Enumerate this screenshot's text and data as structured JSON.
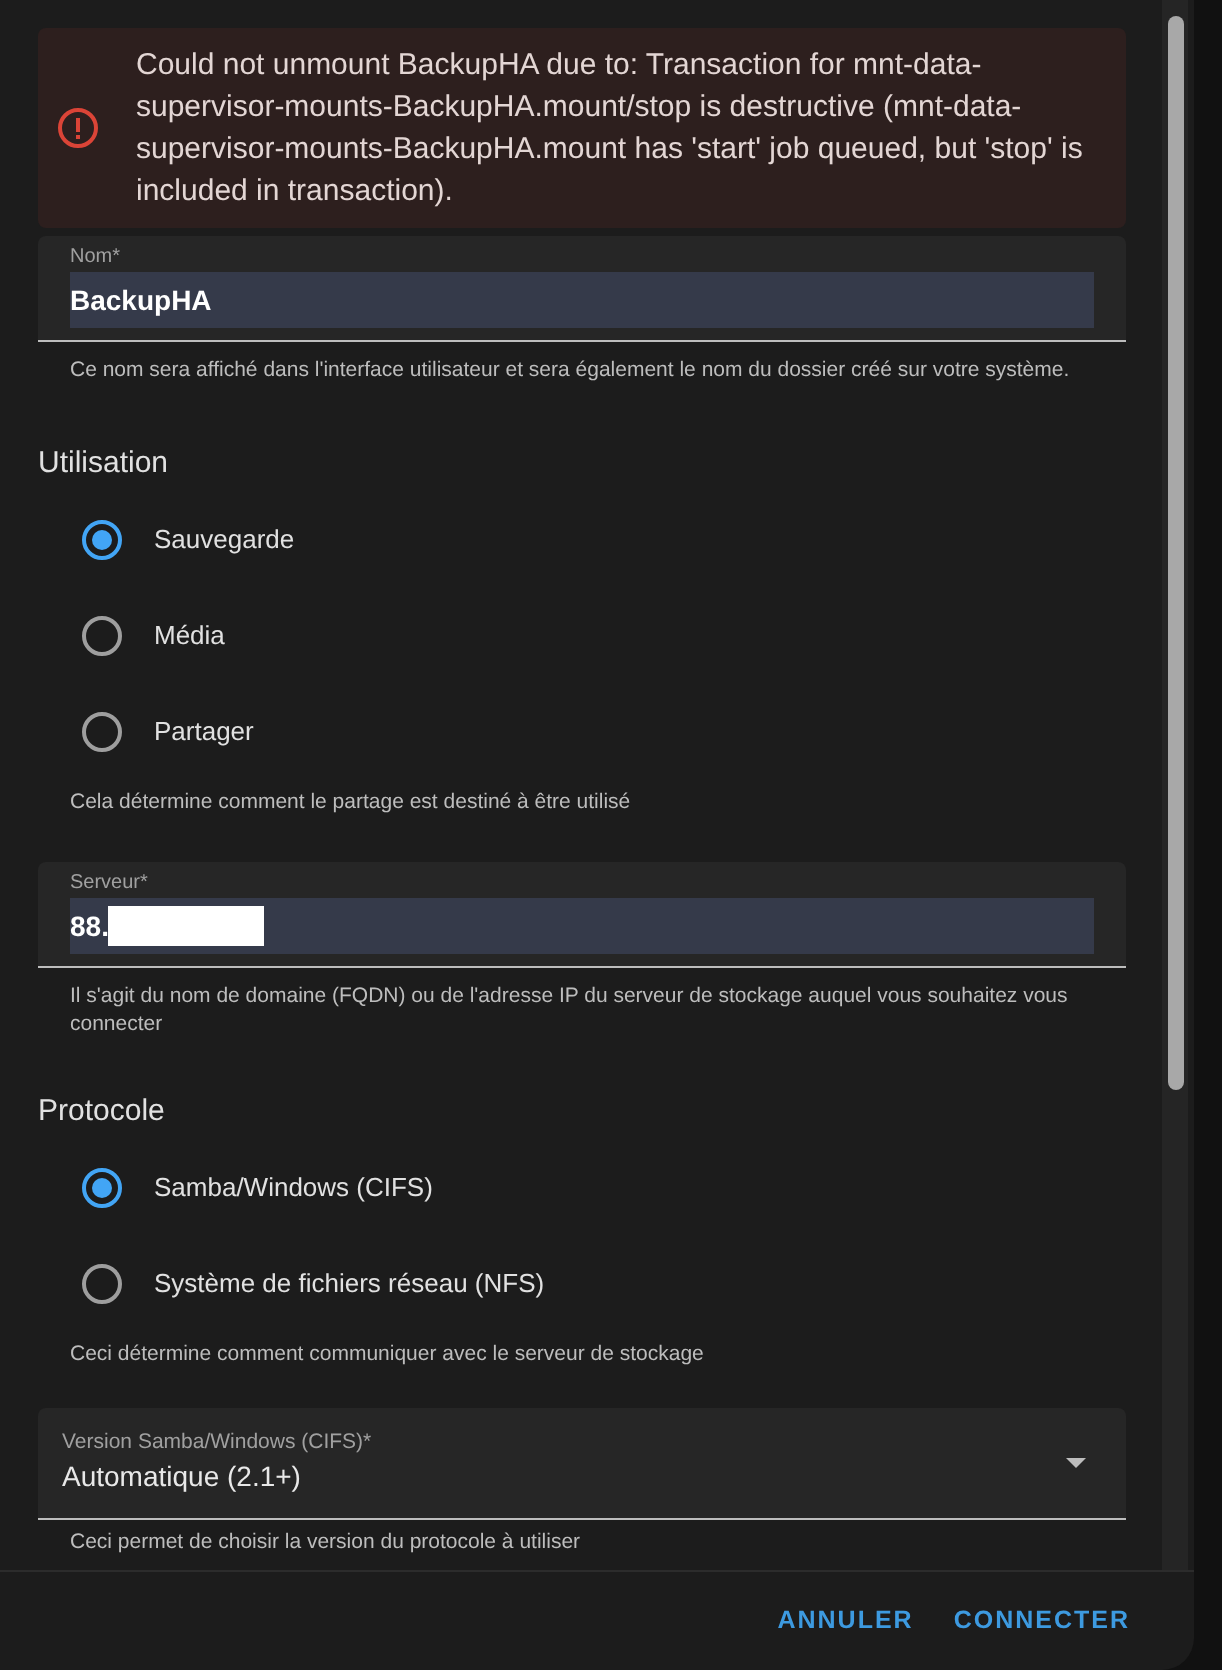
{
  "alert": {
    "message": "Could not unmount BackupHA due to: Transaction for mnt-data-supervisor-mounts-BackupHA.mount/stop is destructive (mnt-data-supervisor-mounts-BackupHA.mount has 'start' job queued, but 'stop' is included in transaction)."
  },
  "name_field": {
    "label": "Nom*",
    "value": "BackupHA",
    "helper": "Ce nom sera affiché dans l'interface utilisateur et sera également le nom du dossier créé sur votre système."
  },
  "usage": {
    "title": "Utilisation",
    "options": [
      {
        "label": "Sauvegarde",
        "selected": true
      },
      {
        "label": "Média",
        "selected": false
      },
      {
        "label": "Partager",
        "selected": false
      }
    ],
    "helper": "Cela détermine comment le partage est destiné à être utilisé"
  },
  "server_field": {
    "label": "Serveur*",
    "value": "88.",
    "redacted": true,
    "helper": "Il s'agit du nom de domaine (FQDN) ou de l'adresse IP du serveur de stockage auquel vous souhaitez vous connecter"
  },
  "protocol": {
    "title": "Protocole",
    "options": [
      {
        "label": "Samba/Windows (CIFS)",
        "selected": true
      },
      {
        "label": "Système de fichiers réseau (NFS)",
        "selected": false
      }
    ],
    "helper": "Ceci détermine comment communiquer avec le serveur de stockage"
  },
  "version_select": {
    "label": "Version Samba/Windows (CIFS)*",
    "value": "Automatique (2.1+)",
    "helper": "Ceci permet de choisir la version du protocole à utiliser"
  },
  "buttons": [
    {
      "label": "ANNULER"
    },
    {
      "label": "CONNECTER"
    }
  ]
}
